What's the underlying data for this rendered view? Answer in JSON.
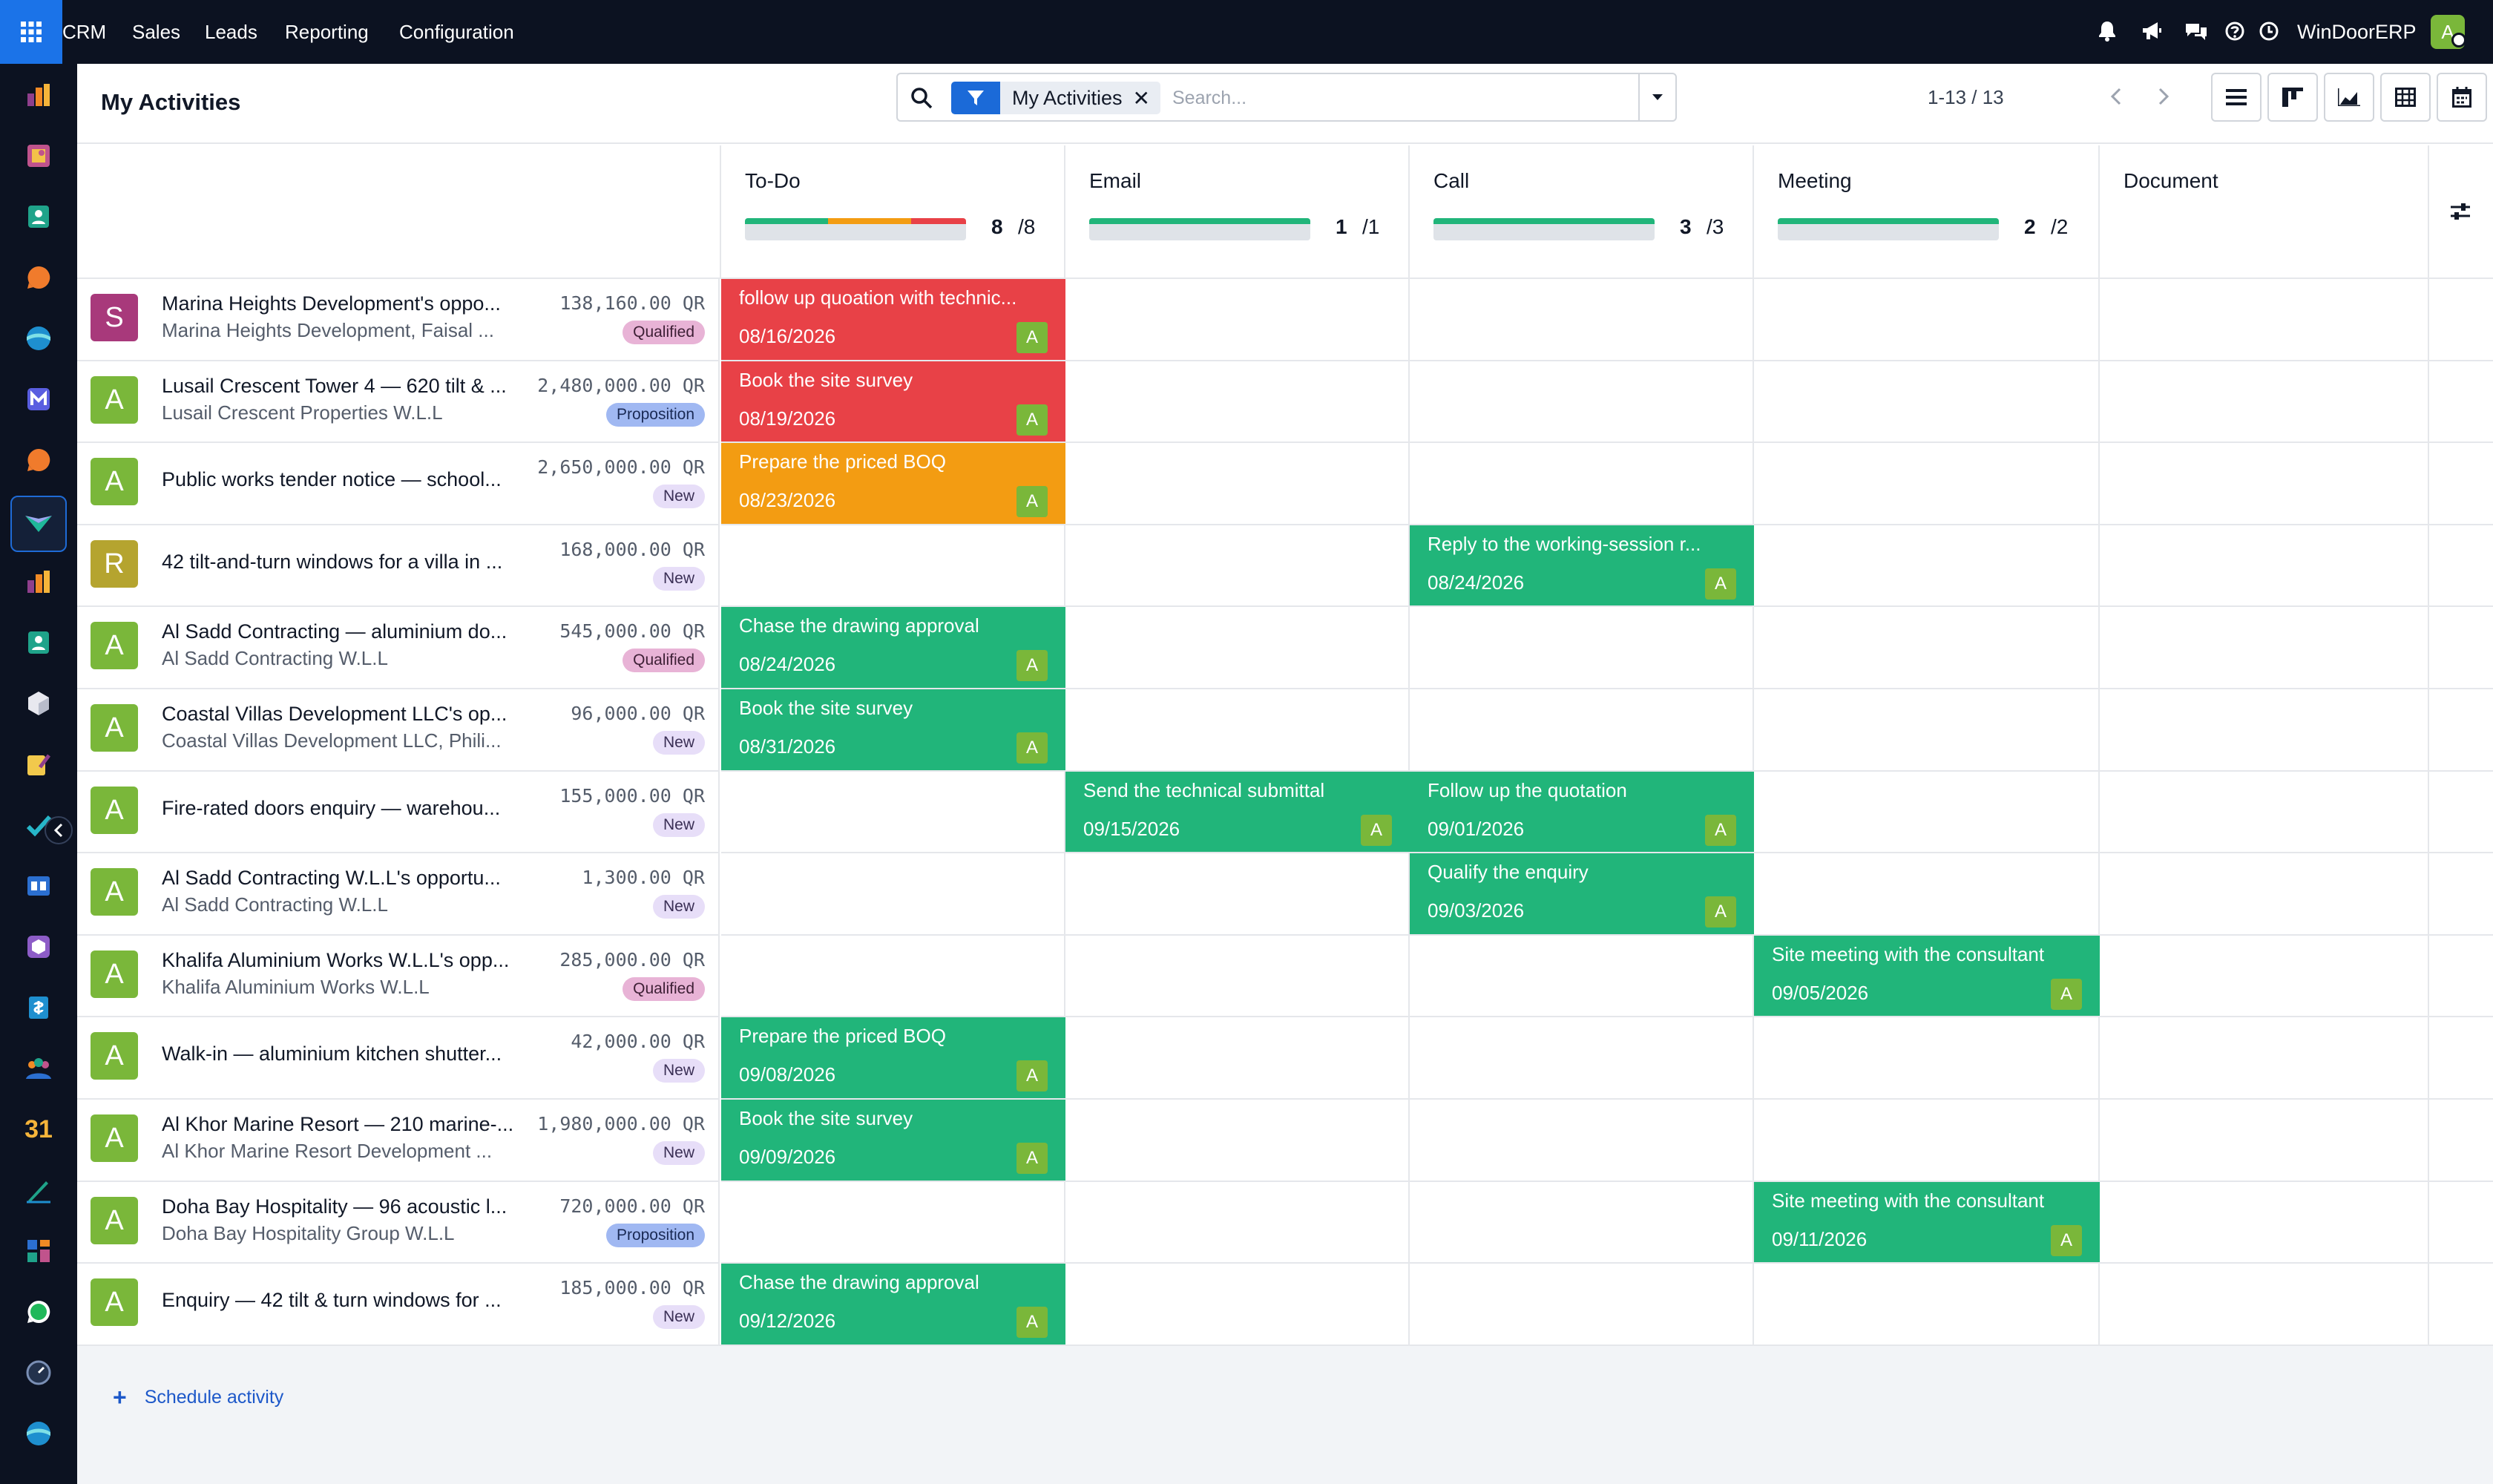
{
  "topbar": {
    "menu": [
      "CRM",
      "Sales",
      "Leads",
      "Reporting",
      "Configuration"
    ],
    "icons": [
      "bell-icon",
      "megaphone-icon",
      "chat-icon",
      "help-icon",
      "clock-icon"
    ],
    "company": "WinDoorERP",
    "user_initial": "A"
  },
  "sidebar": {
    "apps": [
      "sales-app-icon",
      "slides-app-icon",
      "contacts-app-icon",
      "discuss-app-icon",
      "website-app-icon",
      "mail-app-icon",
      "chat-app-icon",
      "crm-app-icon",
      "reporting-app-icon",
      "employees-app-icon",
      "inventory-app-icon",
      "approvals-app-icon",
      "todo-app-icon",
      "knowledge-app-icon",
      "products-app-icon",
      "invoicing-app-icon",
      "team-app-icon",
      "calendar-app-icon",
      "sign-app-icon",
      "dashboards-app-icon",
      "whatsapp-app-icon",
      "timer-app-icon",
      "helpdesk-app-icon"
    ],
    "calendar_label": "31"
  },
  "control_panel": {
    "title": "My Activities",
    "facet_label": "My Activities",
    "search_placeholder": "Search...",
    "pager": "1-13 / 13",
    "views": [
      "list-view-icon",
      "kanban-view-icon",
      "graph-view-icon",
      "pivot-view-icon",
      "calendar-view-icon",
      "activity-view-icon"
    ]
  },
  "columns": [
    {
      "name": "To-Do",
      "count": "8",
      "total": "/8",
      "progress": [
        {
          "color": "#21b57a",
          "value": 3
        },
        {
          "color": "#f39c12",
          "value": 3
        },
        {
          "color": "#e84147",
          "value": 2
        }
      ]
    },
    {
      "name": "Email",
      "count": "1",
      "total": "/1",
      "progress": [
        {
          "color": "#21b57a",
          "value": 1
        }
      ]
    },
    {
      "name": "Call",
      "count": "3",
      "total": "/3",
      "progress": [
        {
          "color": "#21b57a",
          "value": 3
        }
      ]
    },
    {
      "name": "Meeting",
      "count": "2",
      "total": "/2",
      "progress": [
        {
          "color": "#21b57a",
          "value": 2
        }
      ]
    },
    {
      "name": "Document"
    }
  ],
  "stages": {
    "Qualified": {
      "bg": "#e8b3d6",
      "fg": "#3d1f35"
    },
    "Proposition": {
      "bg": "#a0b8f2",
      "fg": "#1a2a55"
    },
    "New": {
      "bg": "#e7def8",
      "fg": "#3a2f55"
    }
  },
  "records": [
    {
      "avatar": "S",
      "avatar_color": "#a8397b",
      "name": "Marina Heights Development's oppo...",
      "partner": "Marina Heights Development, Faisal ...",
      "amount": "138,160.00 QR",
      "stage": "Qualified",
      "activity": {
        "col": 0,
        "summary": "follow up quoation with technic...",
        "date": "08/16/2026",
        "color": "#e84147"
      }
    },
    {
      "avatar": "A",
      "avatar_color": "#7ab73a",
      "name": "Lusail Crescent Tower 4 — 620 tilt & ...",
      "partner": "Lusail Crescent Properties W.L.L",
      "amount": "2,480,000.00 QR",
      "stage": "Proposition",
      "activity": {
        "col": 0,
        "summary": "Book the site survey",
        "date": "08/19/2026",
        "color": "#e84147"
      }
    },
    {
      "avatar": "A",
      "avatar_color": "#7ab73a",
      "name": "Public works tender notice — school...",
      "partner": "",
      "amount": "2,650,000.00 QR",
      "stage": "New",
      "activity": {
        "col": 0,
        "summary": "Prepare the priced BOQ",
        "date": "08/23/2026",
        "color": "#f39c12"
      }
    },
    {
      "avatar": "R",
      "avatar_color": "#b5a42f",
      "name": "42 tilt-and-turn windows for a villa in ...",
      "partner": "",
      "amount": "168,000.00 QR",
      "stage": "New",
      "activity": {
        "col": 2,
        "summary": "Reply to the working-session r...",
        "date": "08/24/2026",
        "color": "#21b57a"
      }
    },
    {
      "avatar": "A",
      "avatar_color": "#7ab73a",
      "name": "Al Sadd Contracting — aluminium do...",
      "partner": "Al Sadd Contracting W.L.L",
      "amount": "545,000.00 QR",
      "stage": "Qualified",
      "activity": {
        "col": 0,
        "summary": "Chase the drawing approval",
        "date": "08/24/2026",
        "color": "#21b57a"
      }
    },
    {
      "avatar": "A",
      "avatar_color": "#7ab73a",
      "name": "Coastal Villas Development LLC's op...",
      "partner": "Coastal Villas Development LLC, Phili...",
      "amount": "96,000.00 QR",
      "stage": "New",
      "activity": {
        "col": 0,
        "summary": "Book the site survey",
        "date": "08/31/2026",
        "color": "#21b57a"
      }
    },
    {
      "avatar": "A",
      "avatar_color": "#7ab73a",
      "name": "Fire-rated doors enquiry — warehou...",
      "partner": "",
      "amount": "155,000.00 QR",
      "stage": "New",
      "activity": {
        "col": 1,
        "summary": "Send the technical submittal",
        "date": "09/15/2026",
        "color": "#21b57a"
      },
      "activity2": {
        "col": 2,
        "summary": "Follow up the quotation",
        "date": "09/01/2026",
        "color": "#21b57a"
      }
    },
    {
      "avatar": "A",
      "avatar_color": "#7ab73a",
      "name": "Al Sadd Contracting W.L.L's opportu...",
      "partner": "Al Sadd Contracting W.L.L",
      "amount": "1,300.00 QR",
      "stage": "New",
      "activity": {
        "col": 2,
        "summary": "Qualify the enquiry",
        "date": "09/03/2026",
        "color": "#21b57a"
      }
    },
    {
      "avatar": "A",
      "avatar_color": "#7ab73a",
      "name": "Khalifa Aluminium Works W.L.L's opp...",
      "partner": "Khalifa Aluminium Works W.L.L",
      "amount": "285,000.00 QR",
      "stage": "Qualified",
      "activity": {
        "col": 3,
        "summary": "Site meeting with the consultant",
        "date": "09/05/2026",
        "color": "#21b57a"
      }
    },
    {
      "avatar": "A",
      "avatar_color": "#7ab73a",
      "name": "Walk-in — aluminium kitchen shutter...",
      "partner": "",
      "amount": "42,000.00 QR",
      "stage": "New",
      "activity": {
        "col": 0,
        "summary": "Prepare the priced BOQ",
        "date": "09/08/2026",
        "color": "#21b57a"
      }
    },
    {
      "avatar": "A",
      "avatar_color": "#7ab73a",
      "name": "Al Khor Marine Resort — 210 marine-...",
      "partner": "Al Khor Marine Resort Development ...",
      "amount": "1,980,000.00 QR",
      "stage": "New",
      "activity": {
        "col": 0,
        "summary": "Book the site survey",
        "date": "09/09/2026",
        "color": "#21b57a"
      }
    },
    {
      "avatar": "A",
      "avatar_color": "#7ab73a",
      "name": "Doha Bay Hospitality — 96 acoustic l...",
      "partner": "Doha Bay Hospitality Group W.L.L",
      "amount": "720,000.00 QR",
      "stage": "Proposition",
      "activity": {
        "col": 3,
        "summary": "Site meeting with the consultant",
        "date": "09/11/2026",
        "color": "#21b57a"
      }
    },
    {
      "avatar": "A",
      "avatar_color": "#7ab73a",
      "name": "Enquiry — 42 tilt & turn windows for ...",
      "partner": "",
      "amount": "185,000.00 QR",
      "stage": "New",
      "activity": {
        "col": 0,
        "summary": "Chase the drawing approval",
        "date": "09/12/2026",
        "color": "#21b57a"
      }
    }
  ],
  "footer": {
    "schedule_label": "Schedule activity"
  }
}
